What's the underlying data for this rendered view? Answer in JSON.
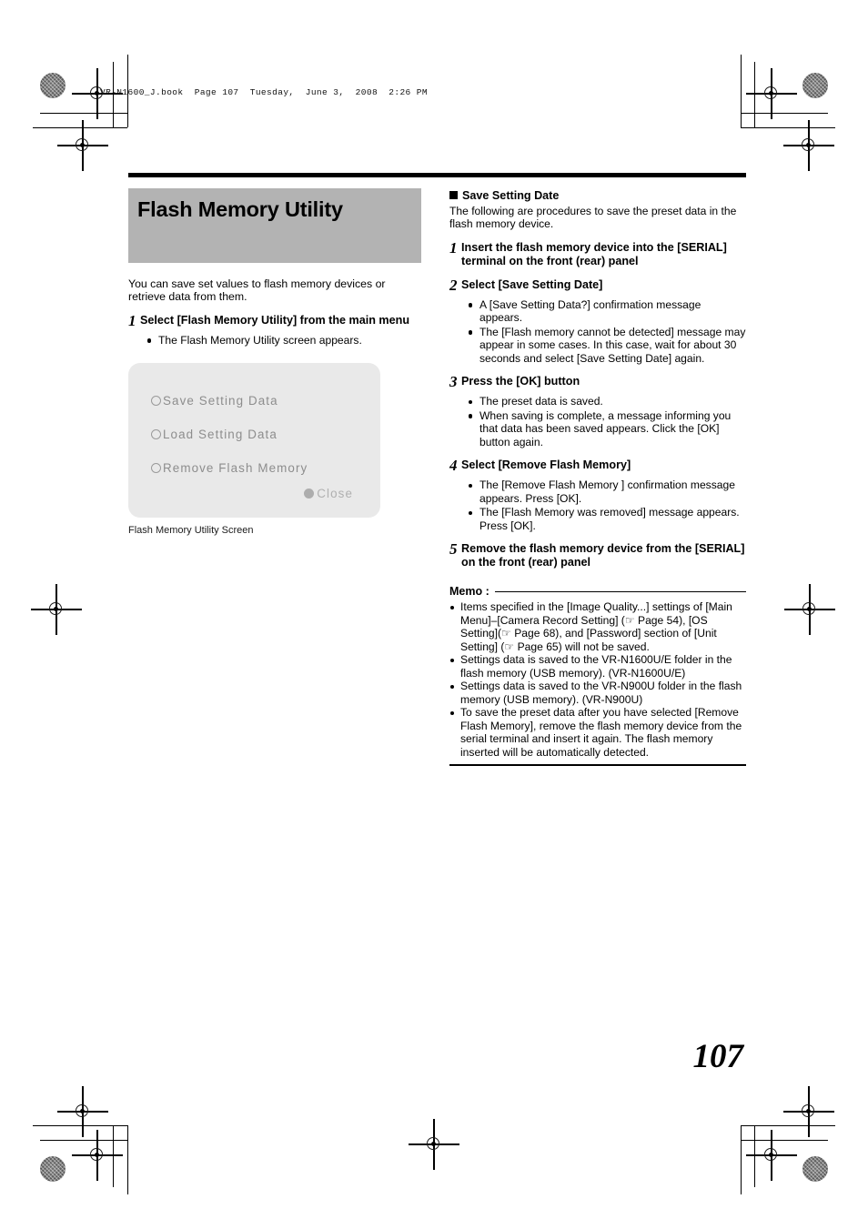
{
  "running_head": "VR-N1600_J.book  Page 107  Tuesday,  June 3,  2008  2:26 PM",
  "page_number": "107",
  "left_column": {
    "title": "Flash Memory Utility",
    "intro": "You can save set values to flash memory devices or retrieve data from them.",
    "step": {
      "number": "1",
      "text": "Select [Flash Memory Utility] from the main menu",
      "bullets": [
        "The Flash Memory Utility screen appears."
      ]
    },
    "device_screen": {
      "options": [
        "Save Setting Data",
        "Load Setting Data",
        "Remove Flash Memory"
      ],
      "close_label": "Close"
    },
    "figure_caption": "Flash Memory Utility Screen"
  },
  "right_column": {
    "section_heading": "Save Setting Date",
    "section_intro": "The following are procedures to save the preset data in the flash memory device.",
    "steps": [
      {
        "number": "1",
        "text": "Insert the flash memory device into the [SERIAL] terminal on the front (rear) panel",
        "bullets": []
      },
      {
        "number": "2",
        "text": "Select [Save Setting Date]",
        "bullets": [
          "A [Save Setting Data?] confirmation message appears.",
          "The [Flash memory cannot be detected] message may appear in some cases.  In this case, wait for about 30 seconds and select [Save Setting Date] again."
        ]
      },
      {
        "number": "3",
        "text": "Press the [OK] button",
        "bullets": [
          "The preset data is saved.",
          "When saving is complete, a message informing you that data has been saved appears. Click the [OK] button again."
        ]
      },
      {
        "number": "4",
        "text": "Select [Remove Flash Memory]",
        "bullets": [
          "The [Remove Flash Memory    ] confirmation message appears. Press [OK].",
          "The [Flash Memory was removed] message appears. Press [OK]."
        ]
      },
      {
        "number": "5",
        "text": "Remove the flash memory device from the [SERIAL] on the front (rear) panel",
        "bullets": []
      }
    ],
    "memo": {
      "label": "Memo :",
      "items": [
        "Items specified in the [Image Quality...] settings of [Main Menu]–[Camera Record Setting] (☞ Page 54), [OS Setting](☞ Page 68), and [Password] section of [Unit Setting] (☞ Page 65) will not be saved.",
        "Settings data is saved to the VR-N1600U/E folder in the flash memory (USB memory).  (VR-N1600U/E)",
        "Settings data is saved to the VR-N900U folder in the flash memory (USB memory).  (VR-N900U)",
        "To save the preset data after you have selected [Remove Flash Memory], remove the flash memory device from the serial terminal and insert it again.  The flash memory inserted will be automatically detected."
      ]
    }
  }
}
